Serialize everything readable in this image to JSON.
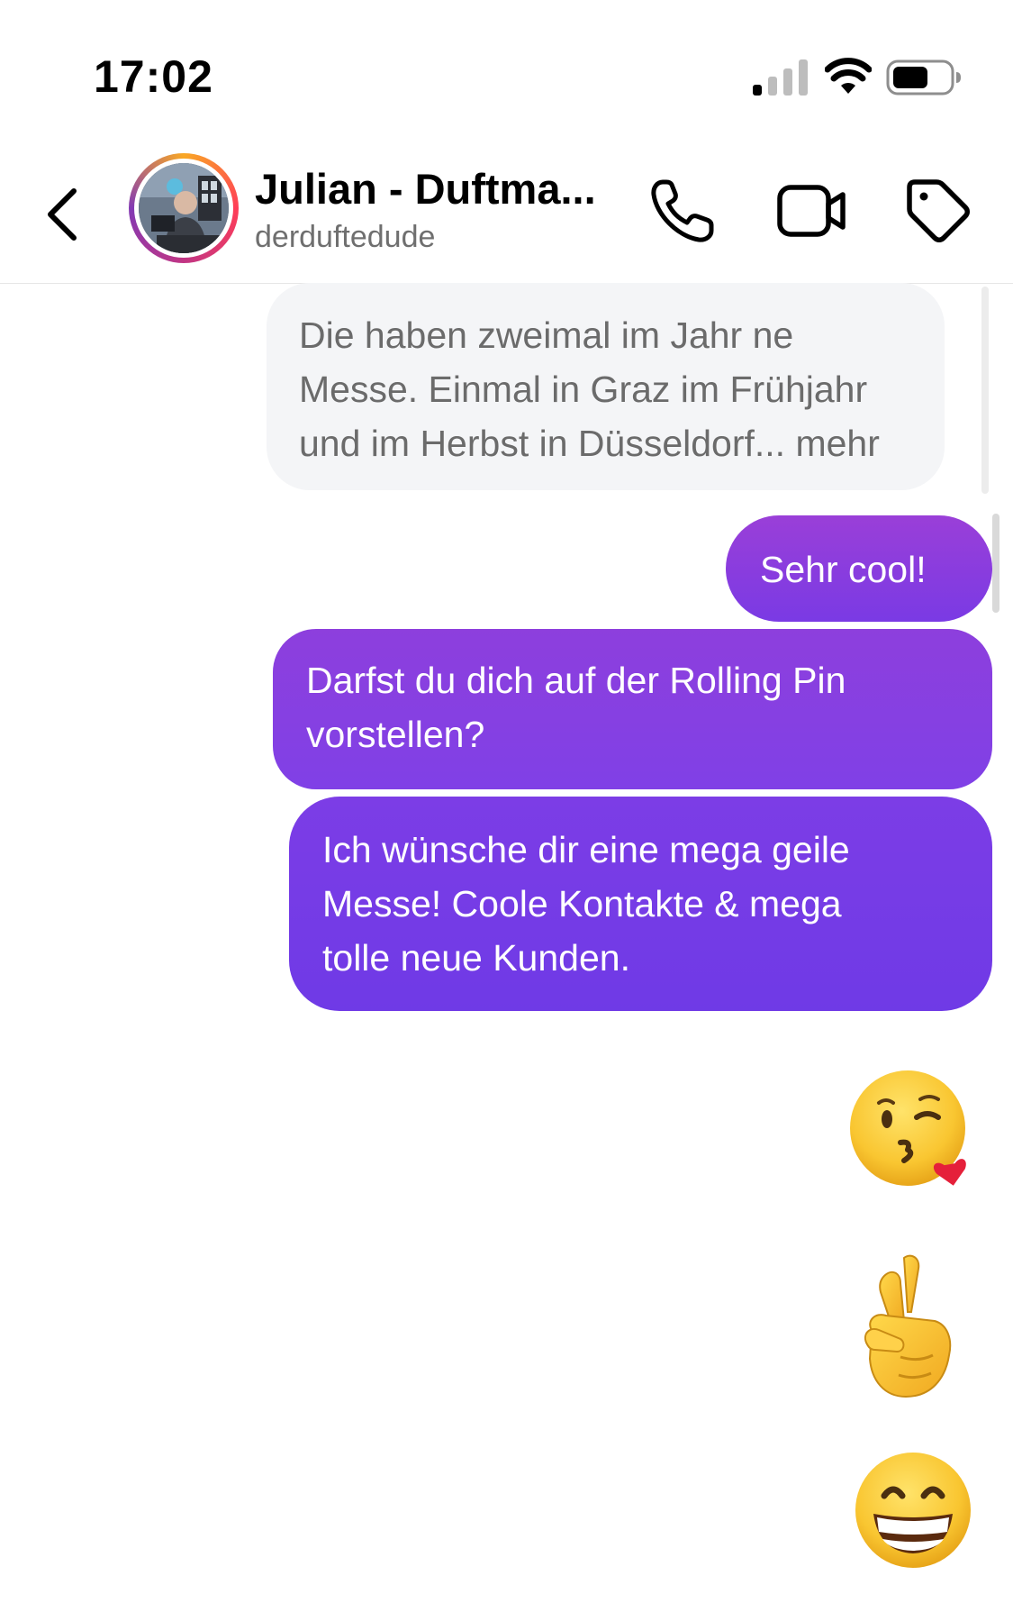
{
  "status_bar": {
    "time": "17:02"
  },
  "header": {
    "contact_name": "Julian - Duftma...",
    "username": "derduftedude"
  },
  "messages": [
    {
      "direction": "received",
      "text": "Die haben zweimal im Jahr ne Messe. Einmal in Graz im Frühjahr und im Herbst in Düsseldorf...",
      "line1": "Die haben zweimal im Jahr ne",
      "line2": "Messe. Einmal in Graz im Frühjahr",
      "line3": "und im Herbst in Düsseldorf...",
      "more_label": "mehr"
    },
    {
      "direction": "sent",
      "text": "Sehr cool!"
    },
    {
      "direction": "sent",
      "text": "Darfst du dich auf der Rolling Pin vorstellen?",
      "line1": "Darfst du dich auf der Rolling Pin",
      "line2": "vorstellen?"
    },
    {
      "direction": "sent",
      "text": "Ich wünsche dir eine mega geile Messe! Coole Kontakte & mega tolle neue Kunden.",
      "line1": "Ich wünsche dir eine mega geile",
      "line2": "Messe! Coole Kontakte & mega",
      "line3": "tolle neue Kunden."
    },
    {
      "direction": "sent",
      "emoji": "face-blowing-a-kiss"
    },
    {
      "direction": "sent",
      "emoji": "crossed-fingers"
    },
    {
      "direction": "sent",
      "emoji": "beaming-face-with-smiling-eyes"
    }
  ],
  "icons": {
    "back": "chevron-left-icon",
    "call": "phone-icon",
    "video": "video-camera-icon",
    "tag": "tag-icon"
  },
  "colors": {
    "sent_bubble_top": "#9a3fd8",
    "sent_bubble_bottom": "#6f3ae6",
    "received_bubble": "#f4f5f7",
    "received_text": "#6b6b6b",
    "username_text": "#6f6f6f"
  }
}
